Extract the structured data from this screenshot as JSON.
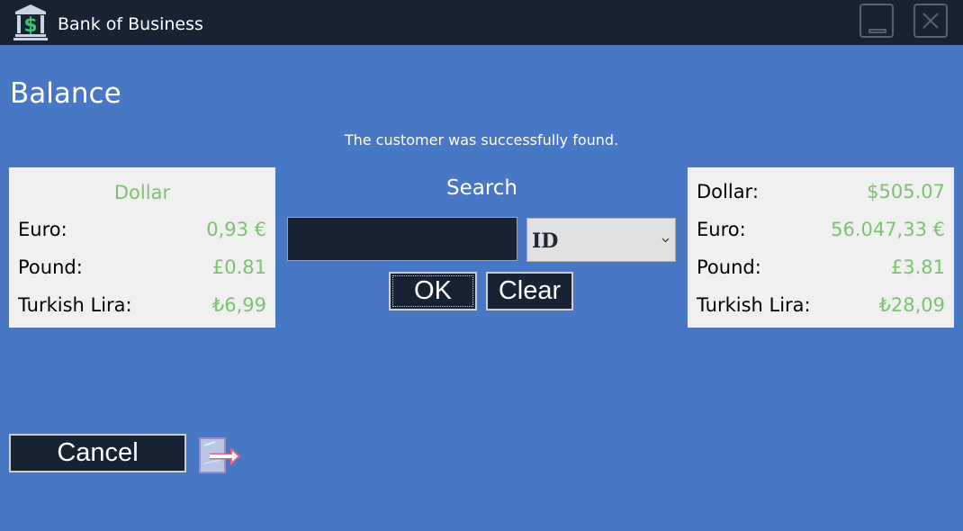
{
  "window": {
    "title": "Bank of Business",
    "logo_icon": "bank-dollar-icon",
    "minimize_icon": "minimize-icon",
    "close_icon": "close-icon"
  },
  "page": {
    "title": "Balance",
    "status": "The customer was successfully found."
  },
  "rates_panel": {
    "header": "Dollar",
    "rows": [
      {
        "label": "Euro:",
        "value": "0,93 €"
      },
      {
        "label": "Pound:",
        "value": "£0.81"
      },
      {
        "label": "Turkish Lira:",
        "value": "₺6,99"
      }
    ]
  },
  "search": {
    "label": "Search",
    "input_value": "",
    "select_value": "ID",
    "ok_label": "OK",
    "clear_label": "Clear"
  },
  "balance_panel": {
    "rows": [
      {
        "label": "Dollar:",
        "value": "$505.07"
      },
      {
        "label": "Euro:",
        "value": "56.047,33 €"
      },
      {
        "label": "Pound:",
        "value": "£3.81"
      },
      {
        "label": "Turkish Lira:",
        "value": "₺28,09"
      }
    ]
  },
  "footer": {
    "cancel_label": "Cancel",
    "exit_icon": "exit-arrow-icon"
  },
  "colors": {
    "titlebar": "#172233",
    "background": "#4877c6",
    "panel": "#f0f0f0",
    "value_green": "#7cc270",
    "button": "#172233"
  }
}
